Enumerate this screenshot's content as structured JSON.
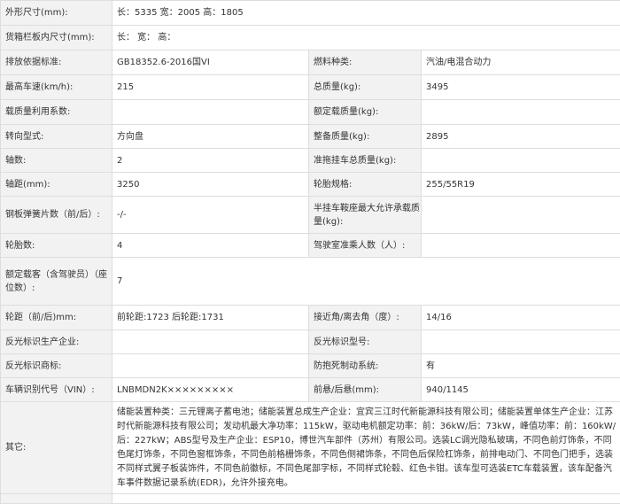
{
  "rows": [
    {
      "k1": "外形尺寸(mm):",
      "v1": "长：5335 宽：2005 高：1805"
    },
    {
      "k1": "货箱栏板内尺寸(mm):",
      "v1": "长： 宽： 高："
    },
    {
      "k1": "排放依据标准:",
      "v1": "GB18352.6-2016国VI",
      "k2": "燃料种类:",
      "v2": "汽油/电混合动力"
    },
    {
      "k1": "最高车速(km/h):",
      "v1": "215",
      "k2": "总质量(kg):",
      "v2": "3495"
    },
    {
      "k1": "载质量利用系数:",
      "v1": "",
      "k2": "额定载质量(kg):",
      "v2": ""
    },
    {
      "k1": "转向型式:",
      "v1": "方向盘",
      "k2": "整备质量(kg):",
      "v2": "2895"
    },
    {
      "k1": "轴数:",
      "v1": "2",
      "k2": "准拖挂车总质量(kg):",
      "v2": ""
    },
    {
      "k1": "轴距(mm):",
      "v1": "3250",
      "k2": "轮胎规格:",
      "v2": "255/55R19"
    },
    {
      "k1": "钢板弹簧片数（前/后）:",
      "v1": "-/-",
      "k2": "半挂车鞍座最大允许承载质量(kg):",
      "v2": ""
    },
    {
      "k1": "轮胎数:",
      "v1": "4",
      "k2": "驾驶室准乘人数（人）:",
      "v2": ""
    },
    {
      "k1": "额定载客（含驾驶员）（座位数）:",
      "v1": "7"
    },
    {
      "k1": "轮距（前/后)mm:",
      "v1": "前轮距:1723 后轮距:1731",
      "k2": "接近角/离去角（度）:",
      "v2": "14/16"
    },
    {
      "k1": "反光标识生产企业:",
      "v1": "",
      "k2": "反光标识型号:",
      "v2": ""
    },
    {
      "k1": "反光标识商标:",
      "v1": "",
      "k2": "防抱死制动系统:",
      "v2": "有"
    },
    {
      "k1": "车辆识别代号（VIN）:",
      "v1": "LNBMDN2K×××××××××",
      "k2": "前悬/后悬(mm):",
      "v2": "940/1145"
    },
    {
      "k1": "其它:",
      "v1": "储能装置种类：三元锂离子蓄电池；储能装置总成生产企业：宜宾三江时代新能源科技有限公司；储能装置单体生产企业：江苏时代新能源科技有限公司；发动机最大净功率：115kW，驱动电机额定功率：前：36kW/后：73kW，峰值功率：前：160kW/后：227kW；ABS型号及生产企业：ESP10，博世汽车部件（苏州）有限公司。选装LC调光隐私玻璃，不同色前灯饰条，不同色尾灯饰条，不同色窗框饰条，不同色前格栅饰条，不同色侧裙饰条，不同色后保险杠饰条，前排电动门、不同色门把手，选装不同样式翼子板装饰件，不同色前徽标，不同色尾部字标，不同样式轮毂、红色卡钳。该车型可选装ETC车载装置，该车配备汽车事件数据记录系统(EDR)，允许外接充电。"
    }
  ]
}
